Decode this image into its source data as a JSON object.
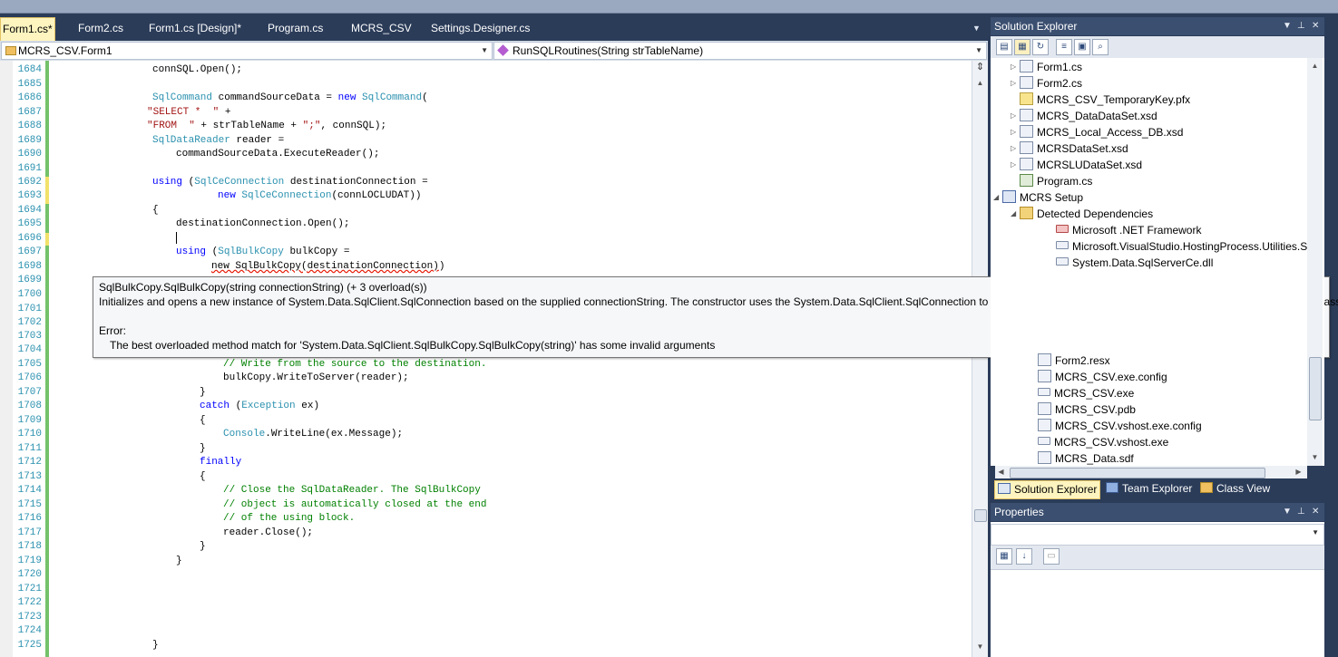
{
  "document_tabs": [
    {
      "label": "Form1.cs*",
      "active": true
    },
    {
      "label": "Form2.cs"
    },
    {
      "label": "Form1.cs [Design]*"
    },
    {
      "label": "Program.cs"
    },
    {
      "label": "MCRS_CSV"
    },
    {
      "label": "Settings.Designer.cs"
    }
  ],
  "navbar": {
    "type_selector": "MCRS_CSV.Form1",
    "member_selector": "RunSQLRoutines(String strTableName)"
  },
  "editor": {
    "line_numbers": [
      "1684",
      "1685",
      "1686",
      "1687",
      "1688",
      "1689",
      "1690",
      "1691",
      "1692",
      "1693",
      "1694",
      "1695",
      "1696",
      "1697",
      "1698",
      "1699",
      "1700",
      "1701",
      "1702",
      "1703",
      "1704",
      "1705",
      "1706",
      "1707",
      "1708",
      "1709",
      "1710",
      "1711",
      "1712",
      "1713",
      "1714",
      "1715",
      "1716",
      "1717",
      "1718",
      "1719",
      "1720",
      "1721",
      "1722",
      "1723",
      "1724",
      "1725"
    ],
    "code": {
      "l1684": "connSQL.Open();",
      "l1686_ty": "SqlCommand",
      "l1686_a": " commandSourceData = ",
      "l1686_kw": "new",
      "l1686_ty2": " SqlCommand",
      "l1686_b": "(",
      "l1687_st": "\"SELECT *  \"",
      "l1687_b": " +",
      "l1688_st": "\"FROM  \"",
      "l1688_b": " + strTableName + ",
      "l1688_st2": "\";\"",
      "l1688_c": ", connSQL);",
      "l1689_ty": "SqlDataReader",
      "l1689_b": " reader =",
      "l1690": "commandSourceData.ExecuteReader();",
      "l1692_kw": "using",
      "l1692_a": " (",
      "l1692_ty": "SqlCeConnection",
      "l1692_b": " destinationConnection =",
      "l1693_kw": "new",
      "l1693_ty": " SqlCeConnection",
      "l1693_b": "(connLOCLUDAT))",
      "l1694": "{",
      "l1695": "destinationConnection.Open();",
      "l1697_kw": "using",
      "l1697_a": " (",
      "l1697_ty": "SqlBulkCopy",
      "l1697_b": " bulkCopy =",
      "l1698_sq": "new SqlBulkCopy(destinationConnection)",
      "l1698_b": ")",
      "l1705": "// Write from the source to the destination.",
      "l1706": "bulkCopy.WriteToServer(reader);",
      "l1707": "}",
      "l1708_kw": "catch",
      "l1708_a": " (",
      "l1708_ty": "Exception",
      "l1708_b": " ex)",
      "l1709": "{",
      "l1710_ty": "Console",
      "l1710_b": ".WriteLine(ex.Message);",
      "l1711": "}",
      "l1712": "finally",
      "l1713": "{",
      "l1714": "// Close the SqlDataReader. The SqlBulkCopy",
      "l1715": "// object is automatically closed at the end",
      "l1716": "// of the using block.",
      "l1717": "reader.Close();",
      "l1718": "}",
      "l1719": "}",
      "l1725": "}"
    }
  },
  "tooltip": {
    "signature": "SqlBulkCopy.SqlBulkCopy(string connectionString)  (+ 3 overload(s))",
    "description": "Initializes and opens a new instance of System.Data.SqlClient.SqlConnection based on the supplied connectionString. The constructor uses the System.Data.SqlClient.SqlConnection to initialize a new instance of the System.Data.SqlClient.SqlBulkCopy class.",
    "error_label": "Error:",
    "error_message": "The best overloaded method match for 'System.Data.SqlClient.SqlBulkCopy.SqlBulkCopy(string)' has some invalid arguments"
  },
  "solution_explorer": {
    "title": "Solution Explorer",
    "items": [
      {
        "label": "Form1.cs",
        "icon": "form-file-icon"
      },
      {
        "label": "Form2.cs",
        "icon": "form-file-icon"
      },
      {
        "label": "MCRS_CSV_TemporaryKey.pfx",
        "icon": "key-file-icon"
      },
      {
        "label": "MCRS_DataDataSet.xsd",
        "icon": "dataset-file-icon"
      },
      {
        "label": "MCRS_Local_Access_DB.xsd",
        "icon": "dataset-file-icon"
      },
      {
        "label": "MCRSDataSet.xsd",
        "icon": "dataset-file-icon"
      },
      {
        "label": "MCRSLUDataSet.xsd",
        "icon": "dataset-file-icon"
      },
      {
        "label": "Program.cs",
        "icon": "cs-file-icon"
      },
      {
        "label": "MCRS Setup",
        "icon": "setup-project-icon"
      },
      {
        "label": "Detected Dependencies",
        "icon": "folder-icon"
      },
      {
        "label": "Microsoft .NET Framework",
        "icon": "framework-icon"
      },
      {
        "label": "Microsoft.VisualStudio.HostingProcess.Utilities.Sy",
        "icon": "reference-icon"
      },
      {
        "label": "System.Data.SqlServerCe.dll",
        "icon": "reference-icon"
      },
      {
        "label": "Form2.resx",
        "icon": "file-icon"
      },
      {
        "label": "MCRS_CSV.exe.config",
        "icon": "file-icon"
      },
      {
        "label": "MCRS_CSV.exe",
        "icon": "reference-icon"
      },
      {
        "label": "MCRS_CSV.pdb",
        "icon": "file-icon"
      },
      {
        "label": "MCRS_CSV.vshost.exe.config",
        "icon": "file-icon"
      },
      {
        "label": "MCRS_CSV.vshost.exe",
        "icon": "reference-icon"
      },
      {
        "label": "MCRS_Data.sdf",
        "icon": "file-icon"
      }
    ]
  },
  "bottom_tabs": [
    {
      "label": "Solution Explorer",
      "active": true
    },
    {
      "label": "Team Explorer"
    },
    {
      "label": "Class View"
    }
  ],
  "properties": {
    "title": "Properties"
  },
  "colors": {
    "ide_background": "#2b3c59",
    "active_tab": "#fdf4bf",
    "keyword": "#0000ff",
    "type": "#2b91af",
    "string": "#a31515",
    "comment": "#008000",
    "line_number": "#2b91af"
  }
}
